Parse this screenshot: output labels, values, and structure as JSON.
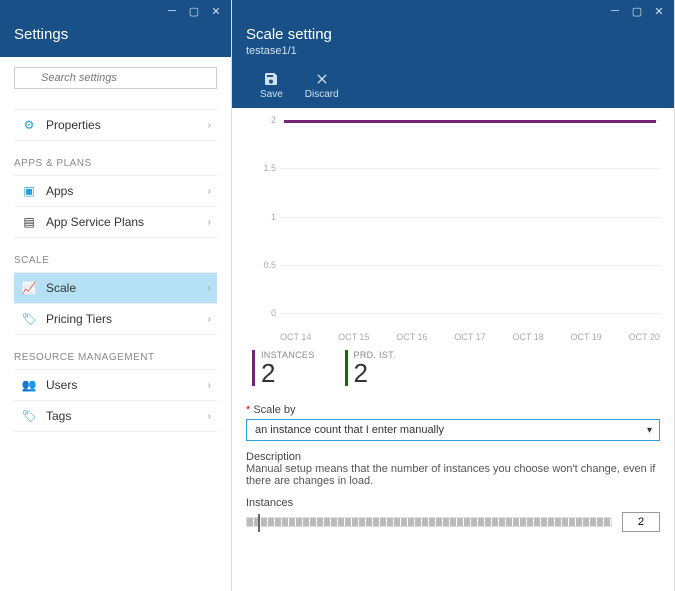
{
  "left": {
    "title": "Settings",
    "search_placeholder": "Search settings",
    "sections": {
      "top": {
        "properties": "Properties"
      },
      "apps_plans": {
        "label": "APPS & PLANS",
        "apps": "Apps",
        "plans": "App Service Plans"
      },
      "scale": {
        "label": "SCALE",
        "scale": "Scale",
        "pricing": "Pricing Tiers"
      },
      "resource": {
        "label": "RESOURCE MANAGEMENT",
        "users": "Users",
        "tags": "Tags"
      }
    }
  },
  "right": {
    "title": "Scale setting",
    "subtitle": "testase1/1",
    "toolbar": {
      "save": "Save",
      "discard": "Discard"
    },
    "stats": {
      "instances_label": "INSTANCES",
      "instances_value": "2",
      "prd_label": "PRD. IST.",
      "prd_value": "2"
    },
    "scale_by_label": "Scale by",
    "scale_by_value": "an instance count that I enter manually",
    "description_head": "Description",
    "description_body": "Manual setup means that the number of instances you choose won't change, even if there are changes in load.",
    "instances_field_label": "Instances",
    "instances_input_value": "2"
  },
  "chart_data": {
    "type": "line",
    "title": "",
    "xlabel": "",
    "ylabel": "",
    "ylim": [
      0,
      2
    ],
    "yticks": [
      0,
      0.5,
      1,
      1.5,
      2
    ],
    "categories": [
      "OCT 14",
      "OCT 15",
      "OCT 16",
      "OCT 17",
      "OCT 18",
      "OCT 19",
      "OCT 20"
    ],
    "series": [
      {
        "name": "INSTANCES",
        "color": "#742574",
        "values": [
          2,
          2,
          2,
          2,
          2,
          2,
          2
        ]
      },
      {
        "name": "PRD. IST.",
        "color": "#097309",
        "values": [
          2,
          2,
          2,
          2,
          2,
          2,
          2
        ]
      }
    ]
  }
}
